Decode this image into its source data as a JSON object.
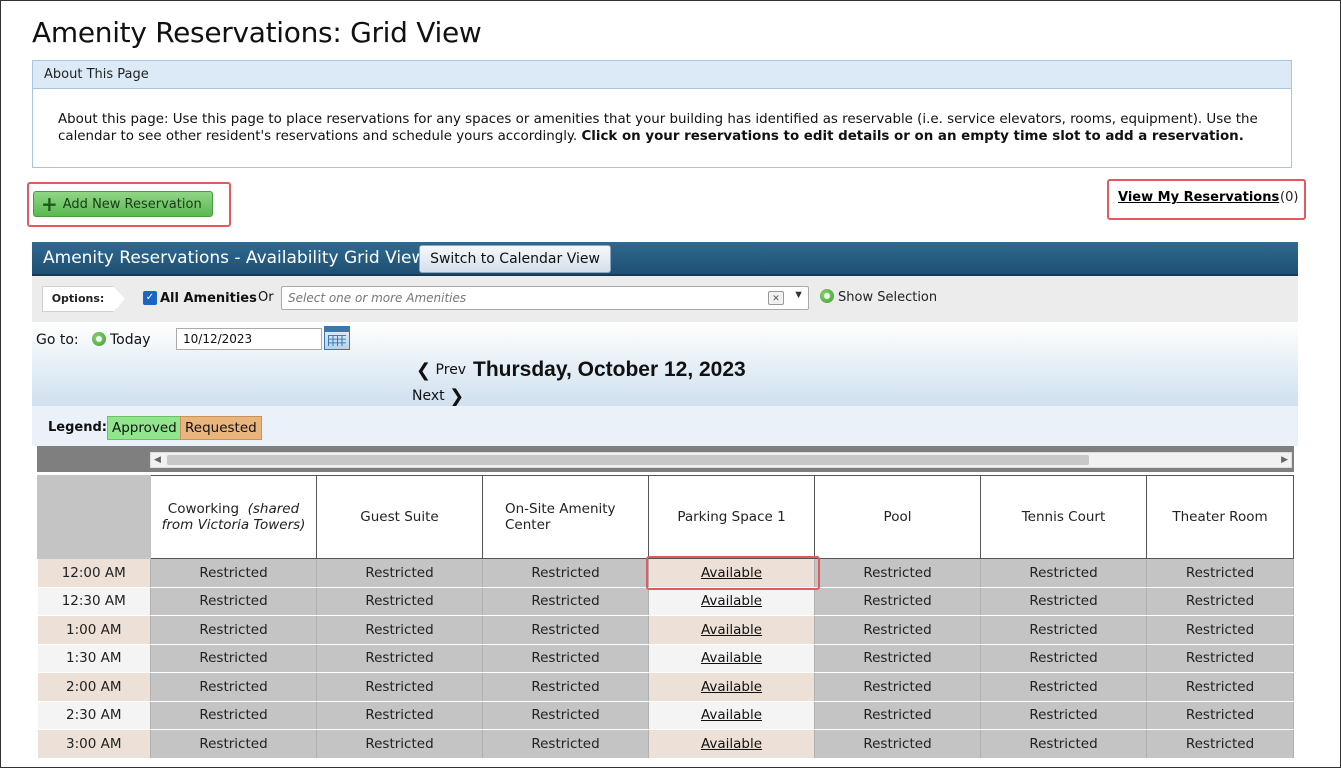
{
  "page": {
    "title": "Amenity Reservations: Grid View"
  },
  "about": {
    "header": "About This Page",
    "text": "About this page: Use this page to place reservations for any spaces or amenities that your building has identified as reservable (i.e. service elevators, rooms, equipment). Use the calendar to see other resident's reservations and schedule yours accordingly.",
    "bold_text": "Click on your reservations to edit details or on an empty time slot to add a reservation."
  },
  "actions": {
    "add_new_label": "Add New Reservation",
    "view_my_label": "View My Reservations",
    "view_my_count": "(0)"
  },
  "grid_header": {
    "title": "Amenity Reservations - Availability Grid View",
    "switch_label": "Switch to Calendar View"
  },
  "options": {
    "tag": "Options:",
    "all_amenities_label": "All Amenities",
    "all_amenities_checked": true,
    "or_label": "Or",
    "select_placeholder": "Select one or more Amenities",
    "show_selection_label": "Show Selection"
  },
  "goto": {
    "label": "Go to:",
    "today_label": "Today",
    "date_value": "10/12/2023",
    "prev_label": "Prev",
    "next_label": "Next",
    "current_date": "Thursday, October 12, 2023"
  },
  "legend": {
    "label": "Legend:",
    "approved": "Approved",
    "requested": "Requested",
    "approved_color": "#90e58d",
    "requested_color": "#eab57d"
  },
  "grid": {
    "amenities": [
      {
        "name": "Coworking",
        "note": "(shared from Victoria Towers)"
      },
      {
        "name": "Guest Suite",
        "note": ""
      },
      {
        "name": "On-Site Amenity Center",
        "note": ""
      },
      {
        "name": "Parking Space 1",
        "note": ""
      },
      {
        "name": "Pool",
        "note": ""
      },
      {
        "name": "Tennis Court",
        "note": ""
      },
      {
        "name": "Theater Room",
        "note": ""
      }
    ],
    "rows": [
      {
        "time": "12:00 AM",
        "cells": [
          "Restricted",
          "Restricted",
          "Restricted",
          "Available",
          "Restricted",
          "Restricted",
          "Restricted"
        ]
      },
      {
        "time": "12:30 AM",
        "cells": [
          "Restricted",
          "Restricted",
          "Restricted",
          "Available",
          "Restricted",
          "Restricted",
          "Restricted"
        ]
      },
      {
        "time": "1:00 AM",
        "cells": [
          "Restricted",
          "Restricted",
          "Restricted",
          "Available",
          "Restricted",
          "Restricted",
          "Restricted"
        ]
      },
      {
        "time": "1:30 AM",
        "cells": [
          "Restricted",
          "Restricted",
          "Restricted",
          "Available",
          "Restricted",
          "Restricted",
          "Restricted"
        ]
      },
      {
        "time": "2:00 AM",
        "cells": [
          "Restricted",
          "Restricted",
          "Restricted",
          "Available",
          "Restricted",
          "Restricted",
          "Restricted"
        ]
      },
      {
        "time": "2:30 AM",
        "cells": [
          "Restricted",
          "Restricted",
          "Restricted",
          "Available",
          "Restricted",
          "Restricted",
          "Restricted"
        ]
      },
      {
        "time": "3:00 AM",
        "cells": [
          "Restricted",
          "Restricted",
          "Restricted",
          "Available",
          "Restricted",
          "Restricted",
          "Restricted"
        ]
      }
    ]
  }
}
